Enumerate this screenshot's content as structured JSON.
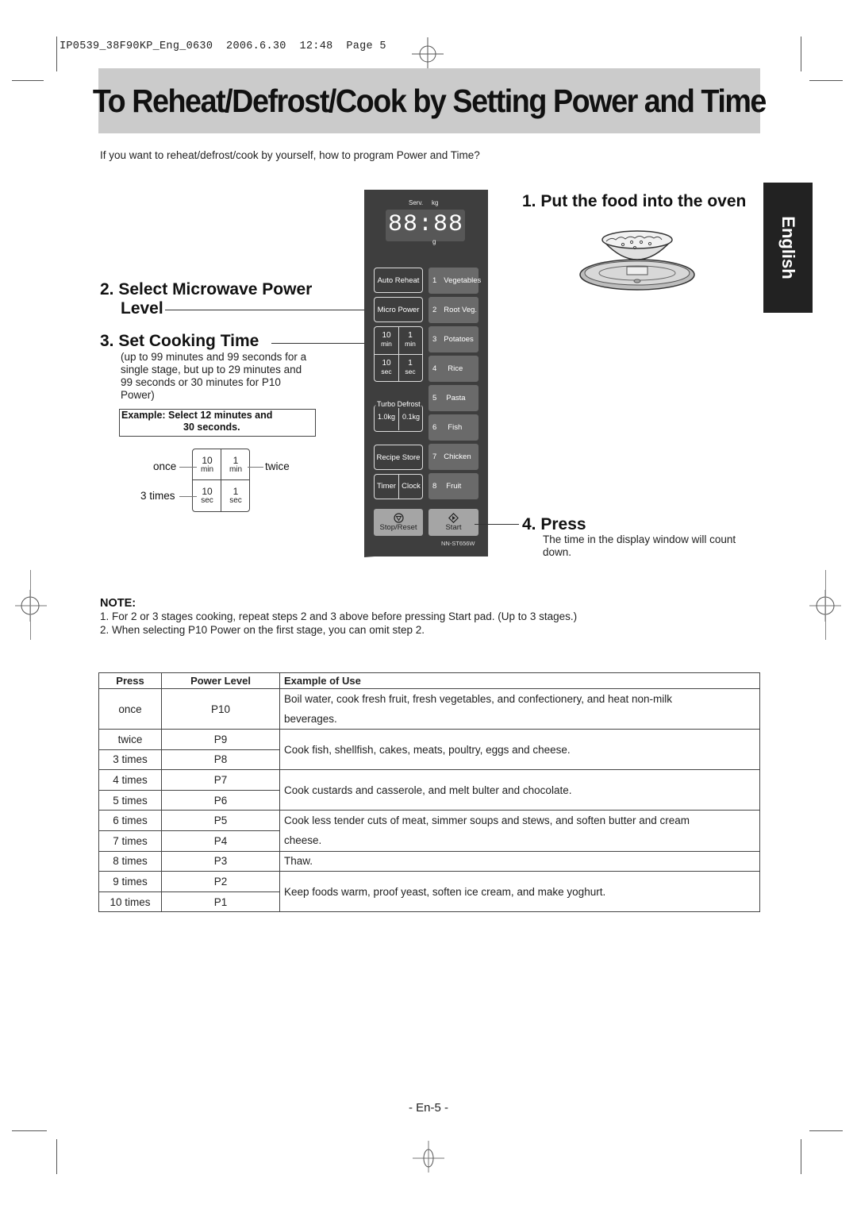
{
  "print_header": {
    "file": "IP0539_38F90KP_Eng_0630",
    "date": "2006.6.30",
    "time": "12:48",
    "page": "Page 5"
  },
  "title": "To Reheat/Defrost/Cook by Setting Power and Time",
  "intro": "If you want to reheat/defrost/cook by yourself, how to program Power and Time?",
  "language_tab": "English",
  "steps": {
    "step1": {
      "number": "1.",
      "title": "Put the food into the oven"
    },
    "step2": {
      "number": "2.",
      "title_line1": "Select Microwave Power",
      "title_line2": "Level"
    },
    "step3": {
      "number": "3.",
      "title": "Set Cooking Time",
      "body_lines": [
        "(up to 99 minutes and 99 seconds for a",
        "single stage, but up to 29 minutes and",
        "99 seconds or 30 minutes for P10",
        "Power)"
      ],
      "example_line1": "Example: Select 12 minutes and",
      "example_line2": "30 seconds.",
      "keypad": {
        "cells": [
          {
            "top": "10",
            "bottom": "min"
          },
          {
            "top": "1",
            "bottom": "min"
          },
          {
            "top": "10",
            "bottom": "sec"
          },
          {
            "top": "1",
            "bottom": "sec"
          }
        ],
        "labels": {
          "ten_min": "once",
          "one_min": "twice",
          "ten_sec": "3 times"
        }
      }
    },
    "step4": {
      "number": "4.",
      "title": "Press",
      "body_lines": [
        "The time in the display window will count",
        "down."
      ]
    }
  },
  "control_panel": {
    "display": {
      "digits": "88:88",
      "label_serv": "Serv.",
      "label_kg": "kg",
      "label_g": "g"
    },
    "left_buttons": {
      "auto_reheat": "Auto Reheat",
      "micro_power": "Micro Power",
      "ten_min": {
        "top": "10",
        "bottom": "min"
      },
      "one_min": {
        "top": "1",
        "bottom": "min"
      },
      "ten_sec": {
        "top": "10",
        "bottom": "sec"
      },
      "one_sec": {
        "top": "1",
        "bottom": "sec"
      },
      "turbo_defrost": "Turbo Defrost",
      "defrost_1kg": "1.0kg",
      "defrost_01kg": "0.1kg",
      "recipe_store": "Recipe Store",
      "timer": "Timer",
      "clock": "Clock"
    },
    "auto_menu": [
      {
        "num": "1",
        "label": "Vegetables"
      },
      {
        "num": "2",
        "label": "Root Veg."
      },
      {
        "num": "3",
        "label": "Potatoes"
      },
      {
        "num": "4",
        "label": "Rice"
      },
      {
        "num": "5",
        "label": "Pasta"
      },
      {
        "num": "6",
        "label": "Fish"
      },
      {
        "num": "7",
        "label": "Chicken"
      },
      {
        "num": "8",
        "label": "Fruit"
      }
    ],
    "stop_reset": "Stop/Reset",
    "start": "Start",
    "model": "NN-ST656W"
  },
  "note": {
    "title": "NOTE:",
    "items": [
      "1. For 2 or 3 stages cooking, repeat steps 2 and 3 above before pressing Start pad. (Up to 3 stages.)",
      "2. When selecting P10 Power on the first stage, you can omit step 2."
    ]
  },
  "power_table": {
    "headers": [
      "Press",
      "Power Level",
      "Example of Use"
    ],
    "rows": [
      {
        "press": "once",
        "level": "P10"
      },
      {
        "press": "twice",
        "level": "P9"
      },
      {
        "press": "3 times",
        "level": "P8"
      },
      {
        "press": "4 times",
        "level": "P7"
      },
      {
        "press": "5 times",
        "level": "P6"
      },
      {
        "press": "6 times",
        "level": "P5"
      },
      {
        "press": "7 times",
        "level": "P4"
      },
      {
        "press": "8 times",
        "level": "P3"
      },
      {
        "press": "9 times",
        "level": "P2"
      },
      {
        "press": "10 times",
        "level": "P1"
      }
    ],
    "uses": [
      "Boil water, cook fresh fruit, fresh vegetables, and confectionery, and heat non-milk beverages.",
      "Cook fish, shellfish, cakes, meats, poultry, eggs and cheese.",
      "Cook custards and casserole, and melt bulter and chocolate.",
      "Cook less tender cuts of meat, simmer soups and stews, and soften butter and cream cheese.",
      "Thaw.",
      "Keep foods warm, proof yeast, soften ice cream, and make yoghurt."
    ]
  },
  "page_number": "- En-5 -"
}
